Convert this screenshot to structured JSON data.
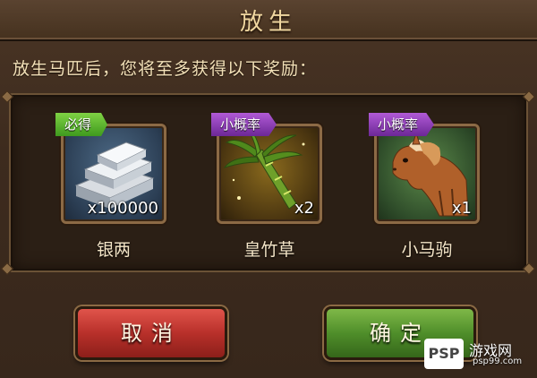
{
  "dialog": {
    "title": "放生",
    "description": "放生马匹后，您将至多获得以下奖励：",
    "rewards": [
      {
        "badge": "必得",
        "badge_color": "#5cb531",
        "name": "银两",
        "count": "x100000",
        "icon": "silver-ingot-icon"
      },
      {
        "badge": "小概率",
        "badge_color": "#8e3fb8",
        "name": "皇竹草",
        "count": "x2",
        "icon": "bamboo-grass-icon"
      },
      {
        "badge": "小概率",
        "badge_color": "#8e3fb8",
        "name": "小马驹",
        "count": "x1",
        "icon": "foal-icon"
      }
    ],
    "buttons": {
      "cancel": "取消",
      "confirm": "确定"
    }
  },
  "watermark": {
    "logo": "PSP",
    "text": "游戏网",
    "url": "psp99.com"
  }
}
